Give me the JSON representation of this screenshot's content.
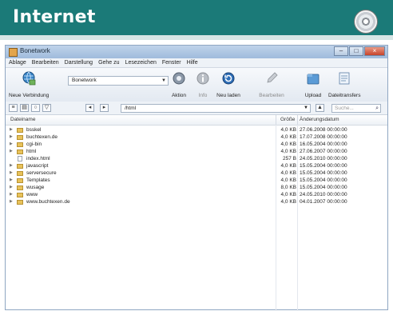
{
  "banner": {
    "title": "Internet"
  },
  "window": {
    "title": "Bonetwork"
  },
  "menu": [
    "Ablage",
    "Bearbeiten",
    "Darstellung",
    "Gehe zu",
    "Lesezeichen",
    "Fenster",
    "Hilfe"
  ],
  "toolbar": {
    "new_connection": "Neue Verbindung",
    "bookmark_combo": "Bonetwork",
    "action": "Aktion",
    "info": "Info",
    "refresh": "Neu laden",
    "edit": "Bearbeiten",
    "upload": "Upload",
    "transfers": "Dateitransfers"
  },
  "address": {
    "path": "/html",
    "search_placeholder": "Suche..."
  },
  "columns": {
    "name": "Dateiname",
    "size": "Größe",
    "modified": "Änderungsdatum"
  },
  "files": [
    {
      "type": "folder",
      "name": "bsskel",
      "size": "4,0 KB",
      "date": "27.06.2008 00:00:00"
    },
    {
      "type": "folder",
      "name": "buchtexen.de",
      "size": "4,0 KB",
      "date": "17.07.2008 00:00:00"
    },
    {
      "type": "folder",
      "name": "cgi-bin",
      "size": "4,0 KB",
      "date": "16.05.2004 00:00:00"
    },
    {
      "type": "folder",
      "name": "html",
      "size": "4,0 KB",
      "date": "27.06.2007 00:00:00"
    },
    {
      "type": "file",
      "name": "index.html",
      "size": "257 B",
      "date": "24.05.2010 00:00:00"
    },
    {
      "type": "folder",
      "name": "javascript",
      "size": "4,0 KB",
      "date": "15.05.2004 00:00:00"
    },
    {
      "type": "folder",
      "name": "serversecure",
      "size": "4,0 KB",
      "date": "15.05.2004 00:00:00"
    },
    {
      "type": "folder",
      "name": "Templates",
      "size": "4,0 KB",
      "date": "15.05.2004 00:00:00"
    },
    {
      "type": "folder",
      "name": "wusage",
      "size": "8,0 KB",
      "date": "15.05.2004 00:00:00"
    },
    {
      "type": "folder",
      "name": "www",
      "size": "4,0 KB",
      "date": "24.05.2010 00:00:00"
    },
    {
      "type": "folder",
      "name": "www.buchtexen.de",
      "size": "4,0 KB",
      "date": "04.01.2007 00:00:00"
    }
  ],
  "colors": {
    "banner": "#1b7a78",
    "folder": "#e8c25a"
  },
  "icons": [
    "cd-icon",
    "globe-icon",
    "gear-icon",
    "info-icon",
    "refresh-icon",
    "pencil-icon",
    "upload-icon",
    "transfers-icon"
  ]
}
